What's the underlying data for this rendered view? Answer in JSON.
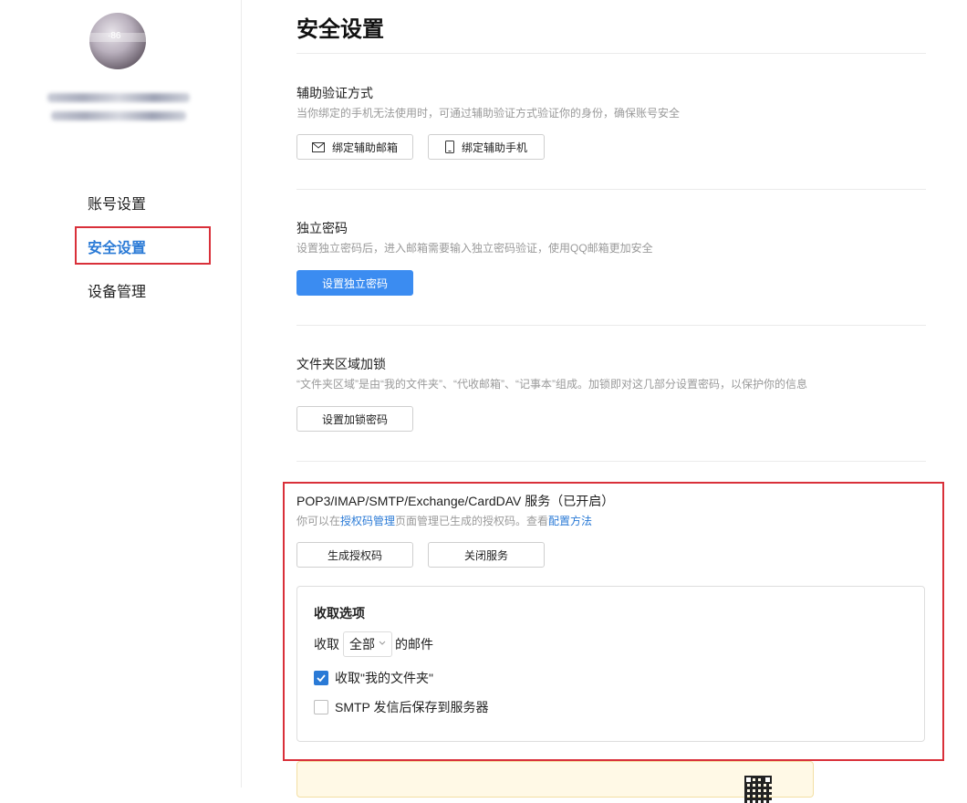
{
  "sidebar": {
    "avatar_text": "·86",
    "nav": [
      {
        "label": "账号设置"
      },
      {
        "label": "安全设置"
      },
      {
        "label": "设备管理"
      }
    ]
  },
  "page": {
    "title": "安全设置"
  },
  "aux_verify": {
    "title": "辅助验证方式",
    "desc": "当你绑定的手机无法使用时，可通过辅助验证方式验证你的身份，确保账号安全",
    "bind_email_label": "绑定辅助邮箱",
    "bind_phone_label": "绑定辅助手机"
  },
  "independent_password": {
    "title": "独立密码",
    "desc": "设置独立密码后，进入邮箱需要输入独立密码验证，使用QQ邮箱更加安全",
    "button_label": "设置独立密码"
  },
  "folder_lock": {
    "title": "文件夹区域加锁",
    "desc": "“文件夹区域”是由“我的文件夹”、“代收邮箱”、“记事本”组成。加锁即对这几部分设置密码，以保护你的信息",
    "button_label": "设置加锁密码"
  },
  "pop_service": {
    "title": "POP3/IMAP/SMTP/Exchange/CardDAV 服务（已开启）",
    "desc_prefix": "你可以在",
    "desc_link1": "授权码管理",
    "desc_middle": "页面管理已生成的授权码。查看",
    "desc_link2": "配置方法",
    "generate_label": "生成授权码",
    "close_label": "关闭服务",
    "options": {
      "title": "收取选项",
      "receive_prefix": "收取",
      "receive_select_value": "全部",
      "receive_suffix": "的邮件",
      "checkbox1_label": "收取\"我的文件夹\"",
      "checkbox1_checked": true,
      "checkbox2_label": "SMTP 发信后保存到服务器",
      "checkbox2_checked": false
    }
  },
  "colors": {
    "accent": "#2a7ad6",
    "primary_button": "#3b8cf1",
    "highlight_border": "#d9303a"
  },
  "icons": [
    "mail-icon",
    "phone-icon",
    "chevron-down-icon",
    "check-icon",
    "qr-code-icon"
  ]
}
